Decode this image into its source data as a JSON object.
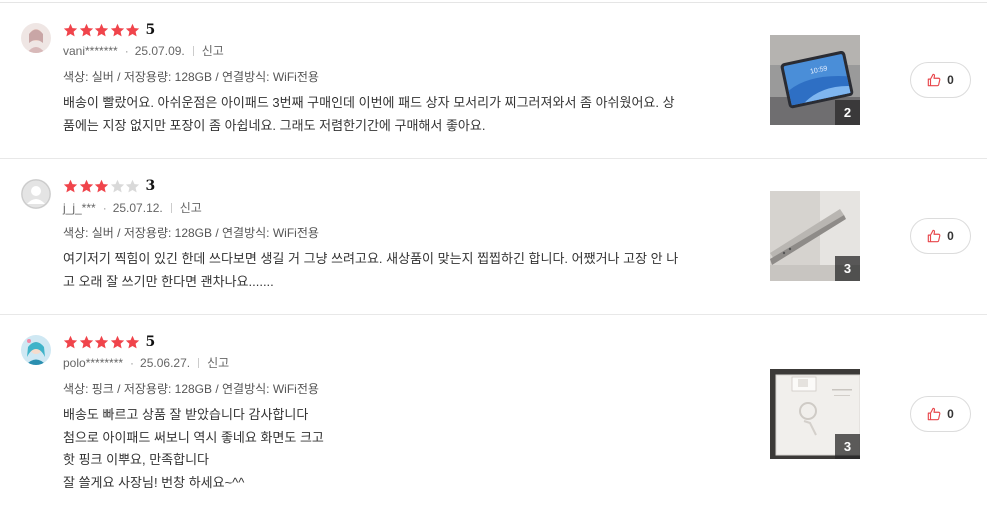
{
  "colors": {
    "star_filled": "#f0444b",
    "star_empty": "#d9d9d9",
    "like_icon": "#e8474c"
  },
  "reviews": [
    {
      "rating": 5,
      "score": "5",
      "user": "vani*******",
      "date": "25.07.09.",
      "report": "신고",
      "options": "색상: 실버 / 저장용량: 128GB / 연결방식: WiFi전용",
      "lines": [
        "배송이 빨랐어요. 아쉬운점은 아이패드 3번째 구매인데 이번에 패드 상자 모서리가 찌그러져와서 좀 아쉬웠어요. 상",
        "품에는 지장 없지만 포장이 좀 아쉽네요. 그래도 저렴한기간에 구매해서 좋아요."
      ],
      "photo_count": "2",
      "photo_clock": "10:59",
      "likes": "0"
    },
    {
      "rating": 3,
      "score": "3",
      "user": "j_j_***",
      "date": "25.07.12.",
      "report": "신고",
      "options": "색상: 실버 / 저장용량: 128GB / 연결방식: WiFi전용",
      "lines": [
        "여기저기 찍힘이 있긴 한데 쓰다보면 생길 거 그냥 쓰려고요. 새상품이 맞는지 찝찝하긴 합니다. 어쨌거나 고장 안 나",
        "고 오래 잘 쓰기만 한다면 괜차나요......."
      ],
      "photo_count": "3",
      "likes": "0"
    },
    {
      "rating": 5,
      "score": "5",
      "user": "polo********",
      "date": "25.06.27.",
      "report": "신고",
      "options": "색상: 핑크 / 저장용량: 128GB / 연결방식: WiFi전용",
      "lines": [
        "배송도 빠르고 상품 잘 받았습니다 감사합니다",
        "첨으로 아이패드 써보니 역시 좋네요 화면도 크고",
        "핫 핑크 이뿌요, 만족합니다",
        "잘 쓸게요 사장님! 번창 하세요~^^"
      ],
      "photo_count": "3",
      "likes": "0"
    }
  ]
}
